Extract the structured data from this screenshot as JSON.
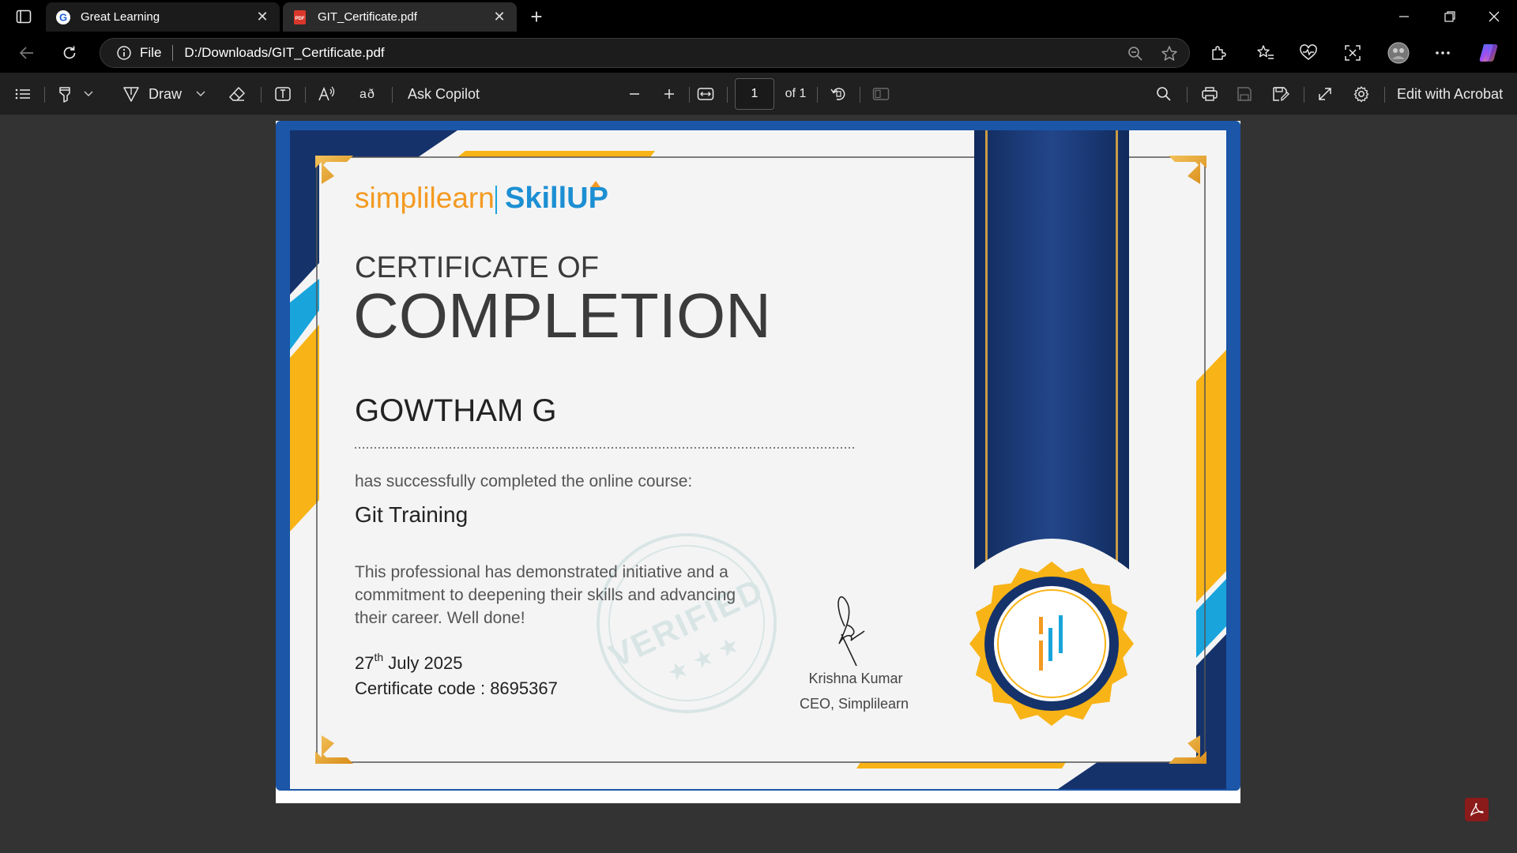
{
  "browser": {
    "tabs": [
      {
        "label": "Great Learning",
        "favicon": "great-learning-g-icon",
        "active": false
      },
      {
        "label": "GIT_Certificate.pdf",
        "favicon": "pdf-file-icon",
        "active": true
      }
    ],
    "address": {
      "scheme_label": "File",
      "url": "D:/Downloads/GIT_Certificate.pdf"
    }
  },
  "pdf_toolbar": {
    "draw_label": "Draw",
    "copilot_label": "Ask Copilot",
    "page_number": "1",
    "page_total": "of 1",
    "acrobat_label": "Edit with Acrobat"
  },
  "certificate": {
    "brand": {
      "simplilearn": "simplilearn",
      "skillup": "SkillUP"
    },
    "heading_small": "CERTIFICATE OF",
    "heading_large": "COMPLETION",
    "recipient": "GOWTHAM G",
    "completed_text": "has successfully completed the online course:",
    "course": "Git Training",
    "message": [
      "This professional has demonstrated initiative and a",
      "commitment to deepening their skills and advancing",
      "their career. Well done!"
    ],
    "date_day": "27",
    "date_suffix": "th",
    "date_rest": " July 2025",
    "certificate_code": "Certificate code : 8695367",
    "stamp": "VERIFIED",
    "signatory_name": "Krishna Kumar",
    "signatory_title": "CEO, Simplilearn"
  },
  "colors": {
    "navy": "#15326b",
    "royal_blue": "#1b56a8",
    "gold": "#f8b316",
    "cyan": "#19a5dc",
    "orange": "#f39a22",
    "edge_accent": "#0078d4"
  }
}
